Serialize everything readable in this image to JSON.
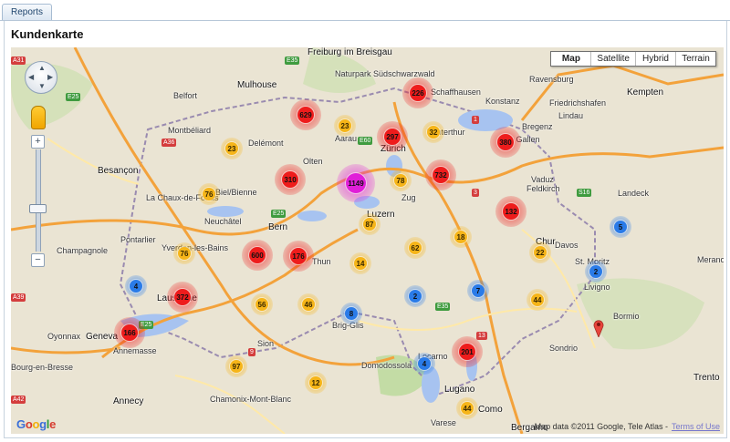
{
  "tab": {
    "label": "Reports"
  },
  "page": {
    "title": "Kundenkarte"
  },
  "map_type_buttons": [
    "Map",
    "Satellite",
    "Hybrid",
    "Terrain"
  ],
  "attribution": {
    "text": "Map data ©2011 Google, Tele Atlas -",
    "terms": "Terms of Use"
  },
  "logo": "Google",
  "colors": {
    "small": "#f6b519",
    "medium": "#ee1c1c",
    "large": "#e01fd8",
    "blue": "#2a7be8",
    "lake": "#a7c3f0",
    "land": "#eae4d3"
  },
  "places": [
    "Freiburg im Breisgau",
    "Naturpark Südschwarzwald",
    "Mulhouse",
    "Belfort",
    "Montbéliard",
    "Besançon",
    "La Chaux-de-Fonds",
    "Neuchâtel",
    "Bern",
    "Biel/Bienne",
    "Thun",
    "Lausanne",
    "Geneva",
    "Annemasse",
    "Annecy",
    "Chamonix-Mont-Blanc",
    "Sion",
    "Brig-Glis",
    "Zürich",
    "Winterthur",
    "Schaffhausen",
    "Konstanz",
    "Ravensburg",
    "Kempten",
    "Lindau",
    "Friedrichshafen",
    "Vaduz",
    "St. Gallen",
    "Chur",
    "Davos",
    "St. Moritz",
    "Bormio",
    "Lugano",
    "Locarno",
    "Como",
    "Varese",
    "Domodossola",
    "Aarau",
    "Luzern",
    "Zug",
    "Olten",
    "Delémont",
    "Yverdon-les-Bains",
    "Pontarlier",
    "Champagnole",
    "Oyonnax",
    "Bourg-en-Bresse",
    "Sondrio",
    "Landeck",
    "Feldkirch",
    "Bregenz",
    "Trento",
    "Merano",
    "Bergamo",
    "Livigno"
  ],
  "clusters": [
    {
      "label": "629",
      "cls": "medium"
    },
    {
      "label": "226",
      "cls": "medium"
    },
    {
      "label": "23",
      "cls": "small"
    },
    {
      "label": "297",
      "cls": "medium"
    },
    {
      "label": "32",
      "cls": "small"
    },
    {
      "label": "380",
      "cls": "medium"
    },
    {
      "label": "23",
      "cls": "small"
    },
    {
      "label": "310",
      "cls": "medium"
    },
    {
      "label": "1149",
      "cls": "large"
    },
    {
      "label": "78",
      "cls": "small"
    },
    {
      "label": "732",
      "cls": "medium"
    },
    {
      "label": "76",
      "cls": "small"
    },
    {
      "label": "132",
      "cls": "medium"
    },
    {
      "label": "87",
      "cls": "small"
    },
    {
      "label": "5",
      "cls": "blue"
    },
    {
      "label": "76",
      "cls": "small"
    },
    {
      "label": "600",
      "cls": "medium"
    },
    {
      "label": "176",
      "cls": "medium"
    },
    {
      "label": "62",
      "cls": "small"
    },
    {
      "label": "18",
      "cls": "small"
    },
    {
      "label": "22",
      "cls": "small"
    },
    {
      "label": "14",
      "cls": "small"
    },
    {
      "label": "2",
      "cls": "blue"
    },
    {
      "label": "4",
      "cls": "blue"
    },
    {
      "label": "372",
      "cls": "medium"
    },
    {
      "label": "56",
      "cls": "small"
    },
    {
      "label": "46",
      "cls": "small"
    },
    {
      "label": "2",
      "cls": "blue"
    },
    {
      "label": "7",
      "cls": "blue"
    },
    {
      "label": "44",
      "cls": "small"
    },
    {
      "label": "8",
      "cls": "blue"
    },
    {
      "label": "166",
      "cls": "medium"
    },
    {
      "label": "201",
      "cls": "medium"
    },
    {
      "label": "97",
      "cls": "small"
    },
    {
      "label": "4",
      "cls": "blue"
    },
    {
      "label": "12",
      "cls": "small"
    },
    {
      "label": "44",
      "cls": "small"
    }
  ]
}
